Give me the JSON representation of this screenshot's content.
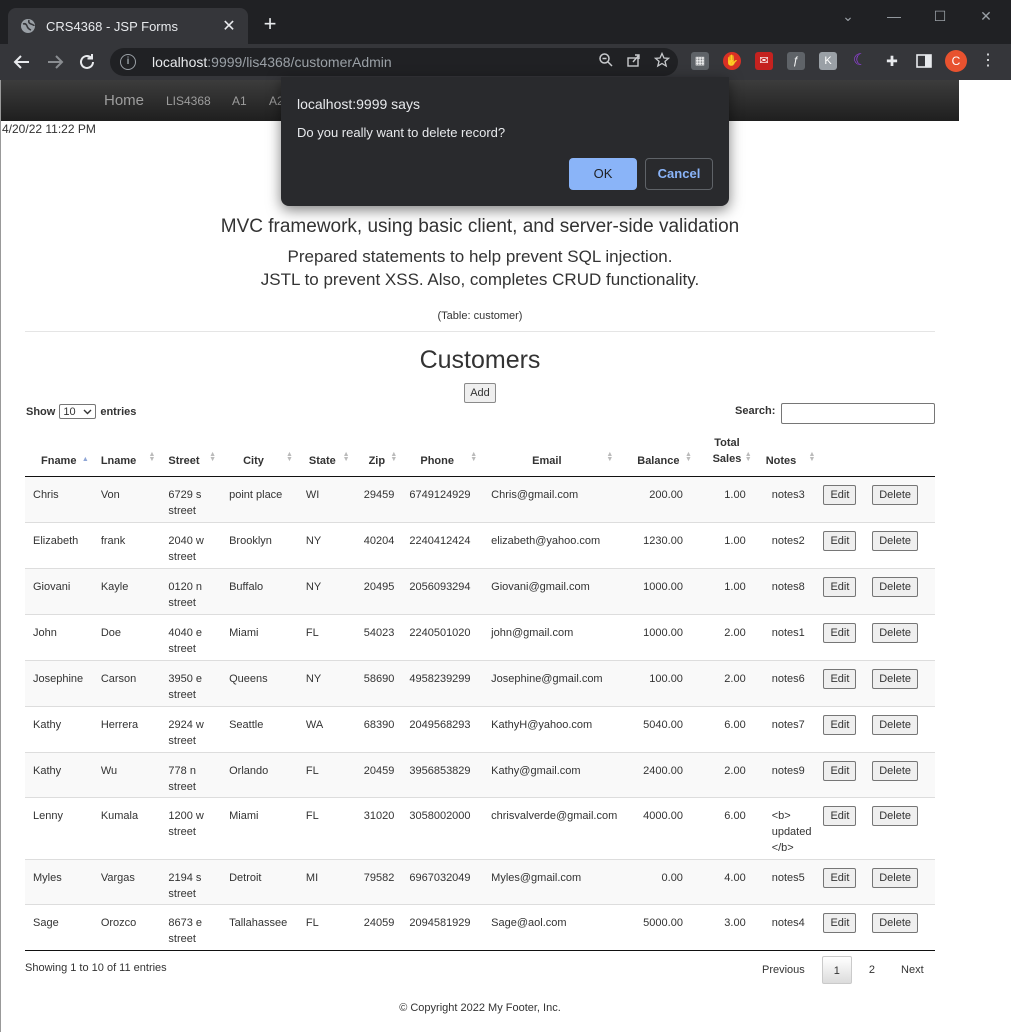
{
  "browser": {
    "tab_title": "CRS4368 - JSP Forms",
    "tab_close": "✕",
    "new_tab": "+",
    "url_host": "localhost",
    "url_rest": ":9999/lis4368/customerAdmin",
    "window_controls": [
      "⌄",
      "—",
      "☐",
      "✕"
    ],
    "profile_initial": "C"
  },
  "appnav": {
    "brand": "Home",
    "links": [
      "LIS4368",
      "A1",
      "A2"
    ]
  },
  "datetime": "4/20/22 11:22 PM",
  "headings": {
    "line1": "MVC framework, using basic client, and server-side validation",
    "line2": "Prepared statements to help prevent SQL injection.",
    "line3": "JSTL to prevent XSS. Also, completes CRUD functionality.",
    "table_note": "(Table: customer)",
    "title": "Customers"
  },
  "add_label": "Add",
  "length": {
    "show": "Show",
    "value": "10",
    "entries": "entries"
  },
  "search_label": "Search:",
  "columns": [
    "Fname",
    "Lname",
    "Street",
    "City",
    "State",
    "Zip",
    "Phone",
    "Email",
    "Balance",
    "Total Sales",
    "Notes"
  ],
  "rows": [
    [
      "Chris",
      "Von",
      "6729 s street",
      "point place",
      "WI",
      "29459",
      "6749124929",
      "Chris@gmail.com",
      "200.00",
      "1.00",
      "notes3"
    ],
    [
      "Elizabeth",
      "frank",
      "2040 w street",
      "Brooklyn",
      "NY",
      "40204",
      "2240412424",
      "elizabeth@yahoo.com",
      "1230.00",
      "1.00",
      "notes2"
    ],
    [
      "Giovani",
      "Kayle",
      "0120 n street",
      "Buffalo",
      "NY",
      "20495",
      "2056093294",
      "Giovani@gmail.com",
      "1000.00",
      "1.00",
      "notes8"
    ],
    [
      "John",
      "Doe",
      "4040 e street",
      "Miami",
      "FL",
      "54023",
      "2240501020",
      "john@gmail.com",
      "1000.00",
      "2.00",
      "notes1"
    ],
    [
      "Josephine",
      "Carson",
      "3950 e street",
      "Queens",
      "NY",
      "58690",
      "4958239299",
      "Josephine@gmail.com",
      "100.00",
      "2.00",
      "notes6"
    ],
    [
      "Kathy",
      "Herrera",
      "2924 w street",
      "Seattle",
      "WA",
      "68390",
      "2049568293",
      "KathyH@yahoo.com",
      "5040.00",
      "6.00",
      "notes7"
    ],
    [
      "Kathy",
      "Wu",
      "778 n street",
      "Orlando",
      "FL",
      "20459",
      "3956853829",
      "Kathy@gmail.com",
      "2400.00",
      "2.00",
      "notes9"
    ],
    [
      "Lenny",
      "Kumala",
      "1200 w street",
      "Miami",
      "FL",
      "31020",
      "3058002000",
      "chrisvalverde@gmail.com",
      "4000.00",
      "6.00",
      "<b> updated </b>"
    ],
    [
      "Myles",
      "Vargas",
      "2194 s street",
      "Detroit",
      "MI",
      "79582",
      "6967032049",
      "Myles@gmail.com",
      "0.00",
      "4.00",
      "notes5"
    ],
    [
      "Sage",
      "Orozco",
      "8673 e street",
      "Tallahassee",
      "FL",
      "24059",
      "2094581929",
      "Sage@aol.com",
      "5000.00",
      "3.00",
      "notes4"
    ]
  ],
  "row_actions": {
    "edit": "Edit",
    "delete": "Delete"
  },
  "table_info": "Showing 1 to 10 of 11 entries",
  "pagination": {
    "previous": "Previous",
    "pages": [
      "1",
      "2"
    ],
    "current": "1",
    "next": "Next"
  },
  "footer": "© Copyright 2022 My Footer, Inc.",
  "dialog": {
    "title": "localhost:9999 says",
    "message": "Do you really want to delete record?",
    "ok": "OK",
    "cancel": "Cancel"
  }
}
